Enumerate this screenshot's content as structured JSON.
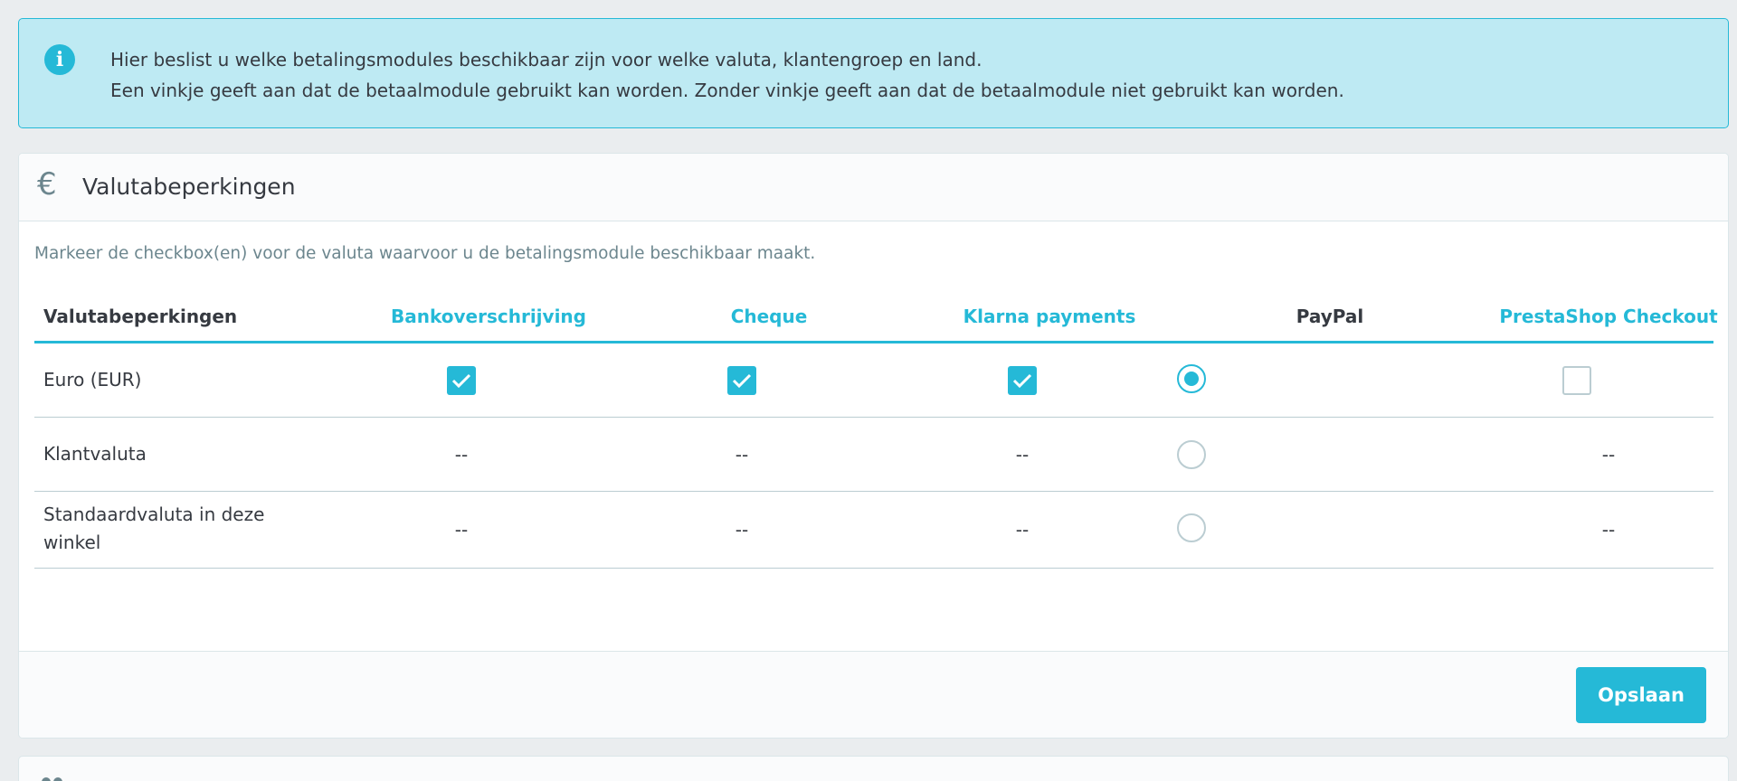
{
  "alert": {
    "icon": "info-icon",
    "line1": "Hier beslist u welke betalingsmodules beschikbaar zijn voor welke valuta, klantengroep en land.",
    "line2": "Een vinkje geeft aan dat de betaalmodule gebruikt kan worden. Zonder vinkje geeft aan dat de betaalmodule niet gebruikt kan worden."
  },
  "panel": {
    "icon": "euro-icon",
    "icon_glyph": "€",
    "title": "Valutabeperkingen",
    "description": "Markeer de checkbox(en) voor de valuta waarvoor u de betalingsmodule beschikbaar maakt.",
    "table": {
      "headers": [
        "Valutabeperkingen",
        "Bankoverschrijving",
        "Cheque",
        "Klarna payments",
        "PayPal",
        "PrestaShop Checkout"
      ],
      "rows": [
        {
          "label": "Euro (EUR)",
          "bank": "checked",
          "cheque": "checked",
          "klarna": "checked",
          "paypal": "radio-selected",
          "prestashop": "unchecked"
        },
        {
          "label": "Klantvaluta",
          "bank": "--",
          "cheque": "--",
          "klarna": "--",
          "paypal": "radio-unselected",
          "prestashop": "--"
        },
        {
          "label_line1": "Standaardvaluta in deze",
          "label_line2": "winkel",
          "bank": "--",
          "cheque": "--",
          "klarna": "--",
          "paypal": "radio-unselected",
          "prestashop": "--"
        }
      ]
    },
    "save_label": "Opslaan"
  },
  "panel2": {
    "icon": "users-icon"
  },
  "colors": {
    "accent": "#25b9d7",
    "alert_bg": "#beeaf3",
    "text": "#363a41",
    "muted": "#6c868e"
  }
}
